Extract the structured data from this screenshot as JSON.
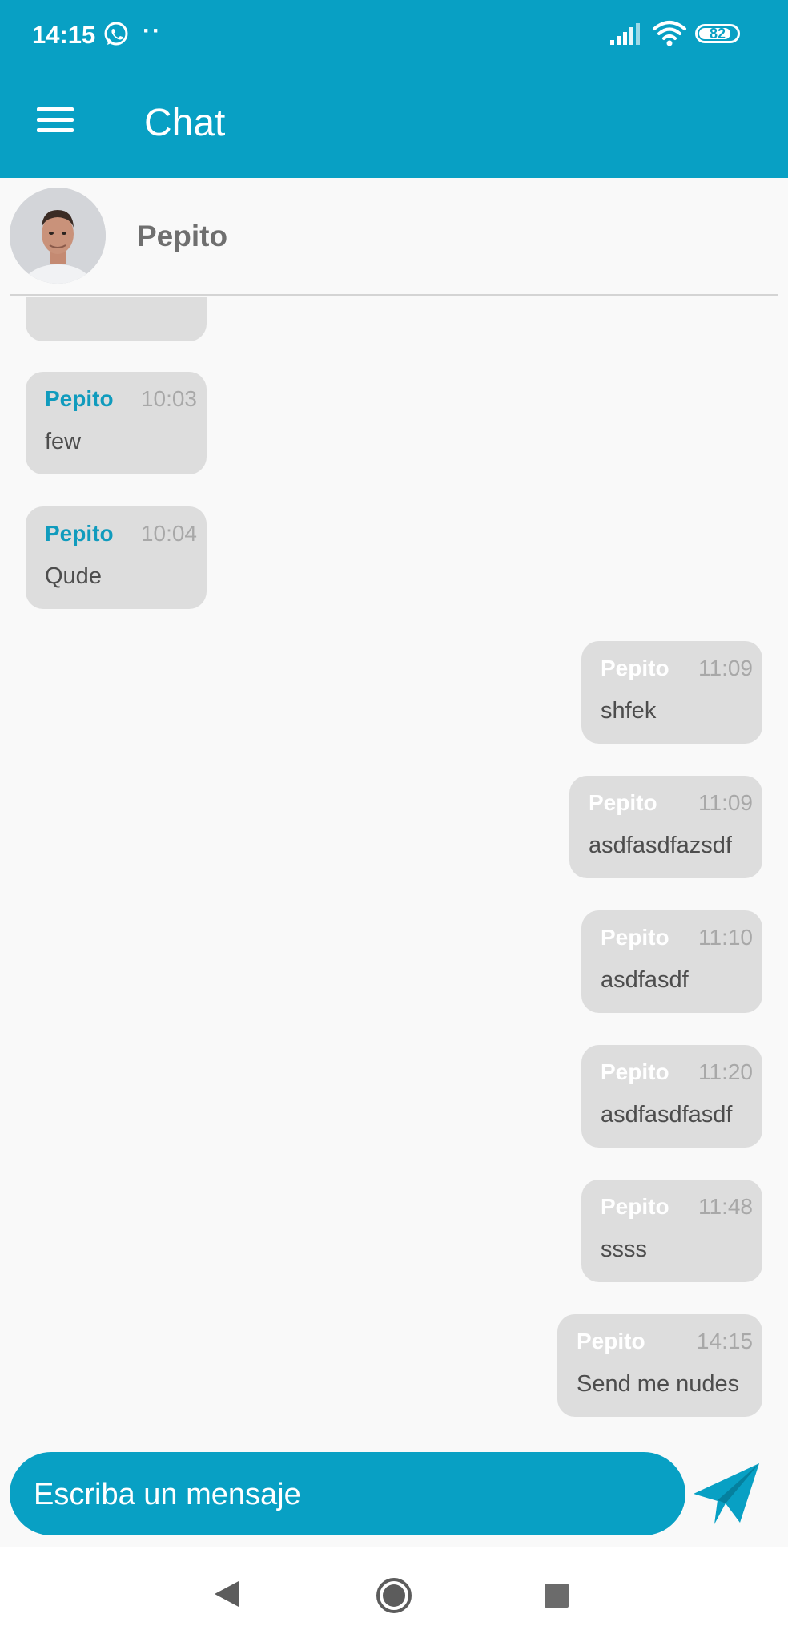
{
  "status_bar": {
    "time": "14:15",
    "dots": "··",
    "battery": "82",
    "icons": [
      "whatsapp-icon",
      "signal-icon",
      "wifi-icon",
      "battery-icon"
    ]
  },
  "app_bar": {
    "title": "Chat",
    "menu_icon": "hamburger-menu-icon",
    "color": "#08a0c4"
  },
  "contact": {
    "name": "Pepito",
    "avatar": "profile-photo"
  },
  "messages": [
    {
      "direction": "incoming",
      "sender": "Pepito",
      "time": "10:03",
      "text": "few"
    },
    {
      "direction": "incoming",
      "sender": "Pepito",
      "time": "10:04",
      "text": "Qude"
    },
    {
      "direction": "outgoing",
      "sender": "Pepito",
      "time": "11:09",
      "text": "shfek"
    },
    {
      "direction": "outgoing",
      "sender": "Pepito",
      "time": "11:09",
      "text": "asdfasdfazsdf"
    },
    {
      "direction": "outgoing",
      "sender": "Pepito",
      "time": "11:10",
      "text": "asdfasdf"
    },
    {
      "direction": "outgoing",
      "sender": "Pepito",
      "time": "11:20",
      "text": "asdfasdfasdf"
    },
    {
      "direction": "outgoing",
      "sender": "Pepito",
      "time": "11:48",
      "text": "ssss"
    },
    {
      "direction": "outgoing",
      "sender": "Pepito",
      "time": "14:15",
      "text": "Send me nudes"
    }
  ],
  "composer": {
    "placeholder": "Escriba un mensaje",
    "value": "",
    "send_icon": "send-icon"
  },
  "nav_bar": {
    "icons": [
      "back-icon",
      "home-icon",
      "recents-icon"
    ]
  },
  "colors": {
    "accent": "#08a0c4",
    "bubble": "#dddddd",
    "sender_incoming": "#109bbd",
    "sender_outgoing": "#ffffff",
    "timestamp": "#a8a8a8"
  }
}
